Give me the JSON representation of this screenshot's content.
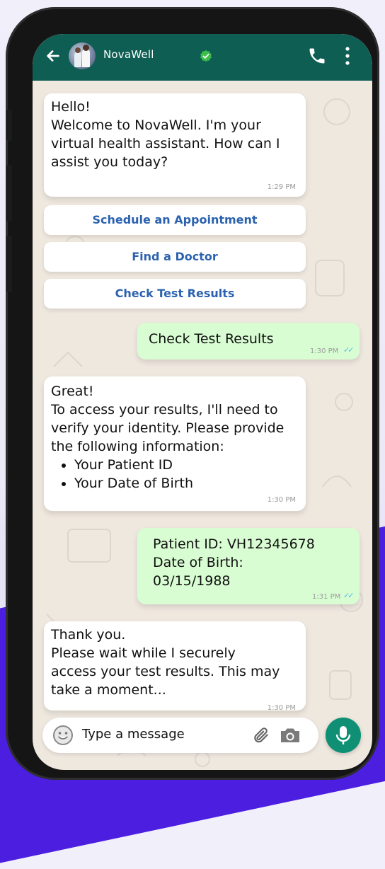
{
  "header": {
    "title": "NovaWell",
    "back_icon": "arrow-left-icon",
    "verified_icon": "verified-check-icon",
    "call_icon": "phone-icon",
    "menu_icon": "more-vertical-icon",
    "color": "#0f5e54"
  },
  "messages": [
    {
      "direction": "incoming",
      "lines": [
        "Hello!",
        "Welcome to NovaWell. I'm your",
        "virtual health assistant. How can I",
        "assist you today?"
      ],
      "time": "1:29 PM"
    },
    {
      "direction": "outgoing",
      "lines": [
        "Check Test Results"
      ],
      "time": "1:30 PM"
    },
    {
      "direction": "incoming",
      "lines": [
        "Great!",
        "To access your results, I'll need to",
        "verify your identity. Please provide",
        "the following information:"
      ],
      "bullets": [
        "Your Patient ID",
        "Your Date of Birth"
      ],
      "time": "1:30 PM"
    },
    {
      "direction": "outgoing",
      "lines": [
        "Patient ID: VH12345678",
        "Date of Birth:",
        "03/15/1988"
      ],
      "time": "1:31 PM"
    },
    {
      "direction": "incoming",
      "lines": [
        "Thank you.",
        "Please wait while I securely",
        "access your test results. This may",
        "take a moment..."
      ],
      "time": "1:30 PM"
    }
  ],
  "quick_replies": [
    "Schedule an Appointment",
    "Find a Doctor",
    "Check Test Results"
  ],
  "composer": {
    "placeholder": "Type a message",
    "emoji_icon": "emoji-icon",
    "attach_icon": "paperclip-icon",
    "camera_icon": "camera-icon",
    "mic_icon": "microphone-icon"
  },
  "colors": {
    "outgoing_bubble": "#d9fdd3",
    "quick_reply_text": "#2b62b0",
    "mic_button": "#0f8f74",
    "read_ticks": "#53bdeb",
    "background_accent": "#4c1fe0"
  }
}
